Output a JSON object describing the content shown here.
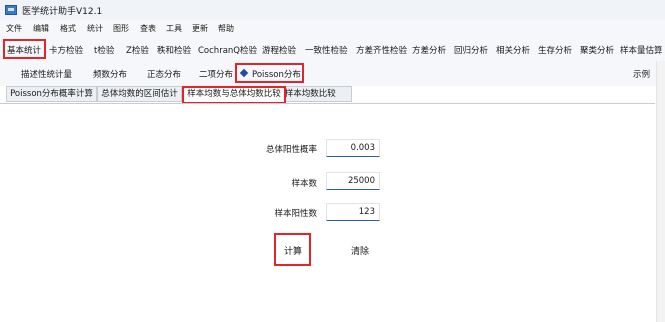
{
  "window": {
    "title": "医学统计助手V12.1",
    "icon": "app-window-icon"
  },
  "menu": [
    "文件",
    "编辑",
    "格式",
    "统计",
    "图形",
    "查表",
    "工具",
    "更新",
    "帮助"
  ],
  "toolbar": {
    "tabs": [
      "基本统计",
      "卡方检验",
      "t检验",
      "Z检验",
      "秩和检验",
      "CochranQ检验",
      "游程检验",
      "一致性检验",
      "方差齐性检验",
      "方差分析",
      "回归分析",
      "相关分析",
      "生存分析",
      "聚类分析",
      "样本量估算"
    ],
    "selected": "基本统计"
  },
  "subtabs": {
    "items": [
      "描述性统计量",
      "频数分布",
      "正态分布",
      "二项分布",
      "Poisson分布"
    ],
    "selected": "Poisson分布",
    "selected_icon": "diamond-icon",
    "right_label": "示例"
  },
  "page_tabs": {
    "items": [
      "Poisson分布概率计算",
      "总体均数的区间估计",
      "样本均数与总体均数比较",
      "两样本均数比较"
    ],
    "selected": "样本均数与总体均数比较"
  },
  "form": {
    "fields": [
      {
        "label": "总体阳性概率",
        "value": "0.003"
      },
      {
        "label": "样本数",
        "value": "25000"
      },
      {
        "label": "样本阳性数",
        "value": "123"
      }
    ],
    "compute_label": "计算",
    "clear_label": "清除"
  },
  "colors": {
    "highlight": "#e0262a",
    "accent": "#1f4e9c",
    "input_underline": "#2a5fb0"
  }
}
